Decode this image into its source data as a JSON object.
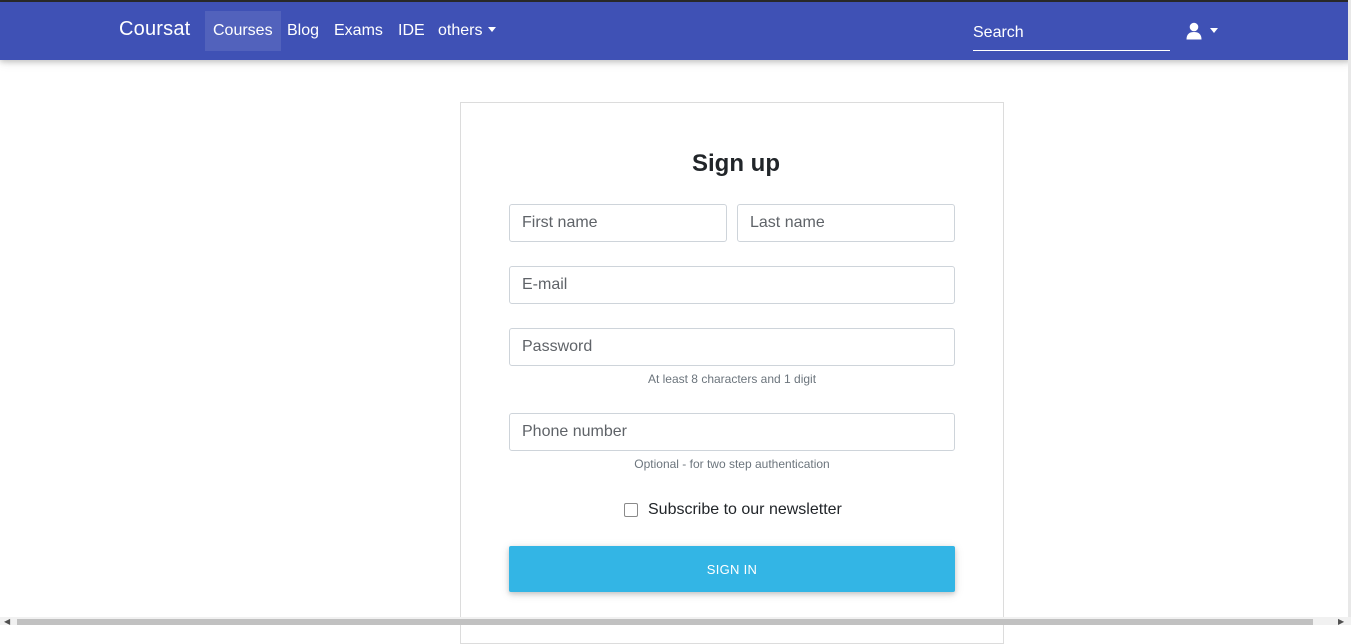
{
  "navbar": {
    "brand": "Coursat",
    "items": [
      {
        "label": "Courses"
      },
      {
        "label": "Blog"
      },
      {
        "label": "Exams"
      },
      {
        "label": "IDE"
      },
      {
        "label": "others"
      }
    ],
    "search_placeholder": "Search",
    "user_icon": "user-icon"
  },
  "colors": {
    "navbar": "#3f51b5",
    "button": "#33b5e5"
  },
  "form": {
    "title": "Sign up",
    "first_name_placeholder": "First name",
    "last_name_placeholder": "Last name",
    "email_placeholder": "E-mail",
    "password_placeholder": "Password",
    "password_hint": "At least 8 characters and 1 digit",
    "phone_placeholder": "Phone number",
    "phone_hint": "Optional - for two step authentication",
    "newsletter_label": "Subscribe to our newsletter",
    "submit_label": "SIGN IN"
  }
}
